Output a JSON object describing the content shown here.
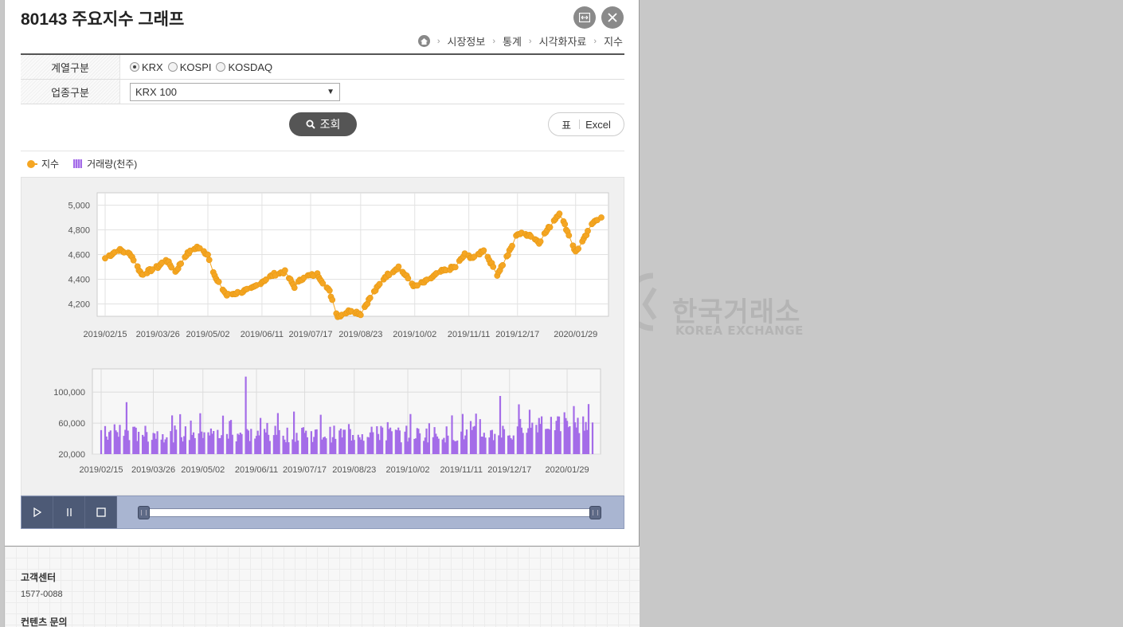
{
  "page": {
    "title": "80143 주요지수 그래프"
  },
  "window_buttons": {
    "expand_icon": "expand-icon",
    "close_icon": "close-icon"
  },
  "breadcrumb": {
    "home_icon": "home-icon",
    "items": [
      "시장정보",
      "통계",
      "시각화자료",
      "지수"
    ]
  },
  "filters": {
    "series_label": "계열구분",
    "series_options": [
      "KRX",
      "KOSPI",
      "KOSDAQ"
    ],
    "series_selected": "KRX",
    "sector_label": "업종구분",
    "sector_value": "KRX 100"
  },
  "buttons": {
    "search_label": "조회",
    "table_label": "표",
    "excel_label": "Excel"
  },
  "legend": {
    "index_label": "지수",
    "volume_label": "거래량(천주)",
    "index_color": "#f5a623",
    "volume_color": "#a46ce8"
  },
  "chart_data": [
    {
      "type": "line",
      "series": [
        {
          "name": "지수"
        }
      ],
      "x_ticks": [
        "2019/02/15",
        "2019/03/26",
        "2019/05/02",
        "2019/06/11",
        "2019/07/17",
        "2019/08/23",
        "2019/10/02",
        "2019/11/11",
        "2019/12/17",
        "2020/01/29"
      ],
      "y_ticks": [
        "4,200",
        "4,400",
        "4,600",
        "4,800",
        "5,000"
      ],
      "ylim": [
        4100,
        5100
      ],
      "grid": true,
      "anchors": [
        {
          "date": "2019/02/15",
          "value": 4570
        },
        {
          "date": "2019/02/25",
          "value": 4640
        },
        {
          "date": "2019/03/06",
          "value": 4600
        },
        {
          "date": "2019/03/14",
          "value": 4440
        },
        {
          "date": "2019/03/26",
          "value": 4500
        },
        {
          "date": "2019/04/01",
          "value": 4560
        },
        {
          "date": "2019/04/08",
          "value": 4460
        },
        {
          "date": "2019/04/16",
          "value": 4600
        },
        {
          "date": "2019/04/24",
          "value": 4660
        },
        {
          "date": "2019/05/02",
          "value": 4600
        },
        {
          "date": "2019/05/08",
          "value": 4400
        },
        {
          "date": "2019/05/16",
          "value": 4270
        },
        {
          "date": "2019/05/24",
          "value": 4290
        },
        {
          "date": "2019/06/03",
          "value": 4320
        },
        {
          "date": "2019/06/11",
          "value": 4380
        },
        {
          "date": "2019/06/20",
          "value": 4440
        },
        {
          "date": "2019/06/28",
          "value": 4460
        },
        {
          "date": "2019/07/05",
          "value": 4340
        },
        {
          "date": "2019/07/12",
          "value": 4420
        },
        {
          "date": "2019/07/22",
          "value": 4440
        },
        {
          "date": "2019/07/31",
          "value": 4300
        },
        {
          "date": "2019/08/06",
          "value": 4100
        },
        {
          "date": "2019/08/16",
          "value": 4150
        },
        {
          "date": "2019/08/23",
          "value": 4120
        },
        {
          "date": "2019/08/30",
          "value": 4250
        },
        {
          "date": "2019/09/10",
          "value": 4420
        },
        {
          "date": "2019/09/20",
          "value": 4500
        },
        {
          "date": "2019/10/02",
          "value": 4340
        },
        {
          "date": "2019/10/10",
          "value": 4380
        },
        {
          "date": "2019/10/21",
          "value": 4460
        },
        {
          "date": "2019/11/01",
          "value": 4500
        },
        {
          "date": "2019/11/08",
          "value": 4600
        },
        {
          "date": "2019/11/15",
          "value": 4570
        },
        {
          "date": "2019/11/22",
          "value": 4640
        },
        {
          "date": "2019/12/02",
          "value": 4440
        },
        {
          "date": "2019/12/10",
          "value": 4600
        },
        {
          "date": "2019/12/17",
          "value": 4770
        },
        {
          "date": "2019/12/26",
          "value": 4760
        },
        {
          "date": "2020/01/02",
          "value": 4700
        },
        {
          "date": "2020/01/10",
          "value": 4830
        },
        {
          "date": "2020/01/17",
          "value": 4940
        },
        {
          "date": "2020/01/24",
          "value": 4760
        },
        {
          "date": "2020/01/29",
          "value": 4620
        },
        {
          "date": "2020/02/04",
          "value": 4720
        },
        {
          "date": "2020/02/12",
          "value": 4880
        },
        {
          "date": "2020/02/17",
          "value": 4900
        }
      ]
    },
    {
      "type": "bar",
      "series": [
        {
          "name": "거래량(천주)"
        }
      ],
      "x_ticks": [
        "2019/02/15",
        "2019/03/26",
        "2019/05/02",
        "2019/06/11",
        "2019/07/17",
        "2019/08/23",
        "2019/10/02",
        "2019/11/11",
        "2019/12/17",
        "2020/01/29"
      ],
      "y_ticks": [
        "20,000",
        "60,000",
        "100,000"
      ],
      "ylim": [
        20000,
        130000
      ],
      "grid": true,
      "peaks": [
        {
          "date": "2019/06/03",
          "value": 120000
        },
        {
          "date": "2019/12/10",
          "value": 95000
        },
        {
          "date": "2019/03/06",
          "value": 87000
        }
      ],
      "typical_range": [
        35000,
        75000
      ]
    }
  ],
  "footer": {
    "cs_title": "고객센터",
    "cs_phone": "1577-0088",
    "contents_title": "컨텐츠 문의"
  },
  "watermark": {
    "name_ko": "한국거래소",
    "name_en": "KOREA EXCHANGE"
  }
}
